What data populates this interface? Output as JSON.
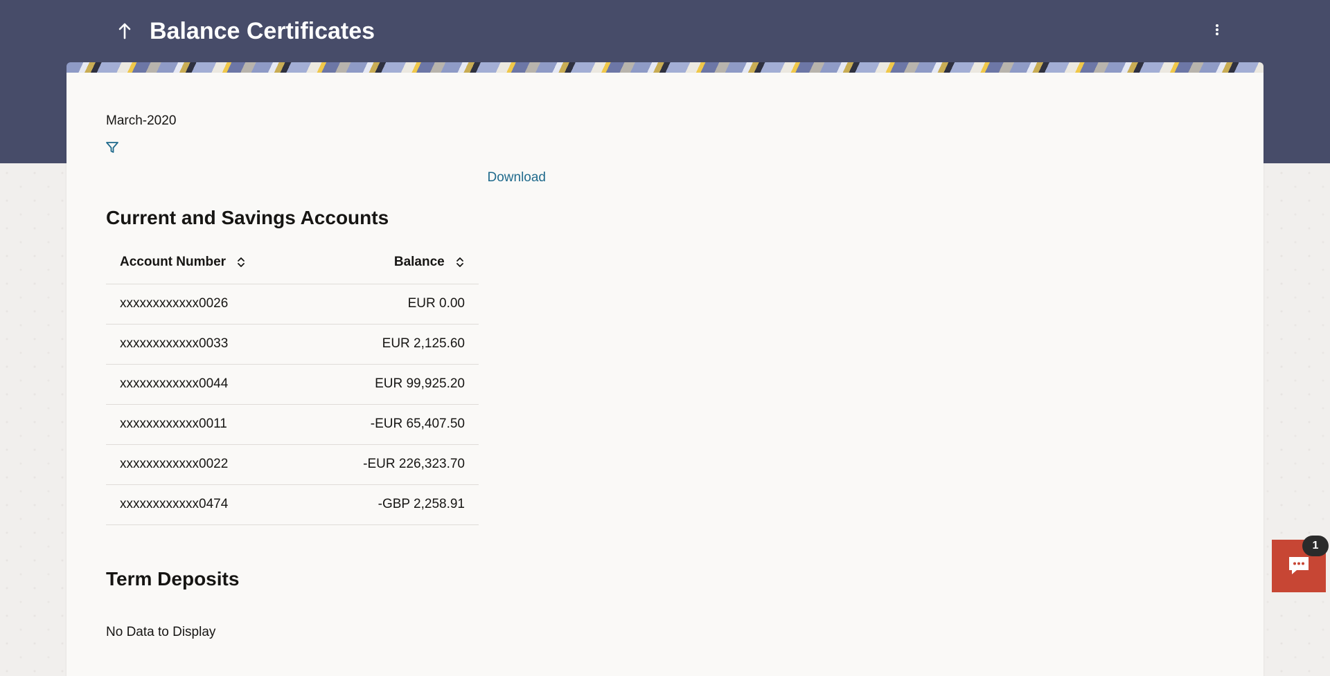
{
  "header": {
    "title": "Balance Certificates",
    "back_icon": "arrow-up-icon",
    "menu_icon": "kebab-menu-icon"
  },
  "filters": {
    "period": "March-2020",
    "filter_icon": "filter-icon"
  },
  "download_label": "Download",
  "casa": {
    "title": "Current and Savings Accounts",
    "columns": {
      "account_number": "Account Number",
      "balance": "Balance"
    },
    "rows": [
      {
        "account": "xxxxxxxxxxxx0026",
        "balance": "EUR 0.00"
      },
      {
        "account": "xxxxxxxxxxxx0033",
        "balance": "EUR 2,125.60"
      },
      {
        "account": "xxxxxxxxxxxx0044",
        "balance": "EUR 99,925.20"
      },
      {
        "account": "xxxxxxxxxxxx0011",
        "balance": "-EUR 65,407.50"
      },
      {
        "account": "xxxxxxxxxxxx0022",
        "balance": "-EUR 226,323.70"
      },
      {
        "account": "xxxxxxxxxxxx0474",
        "balance": "-GBP 2,258.91"
      }
    ]
  },
  "term_deposits": {
    "title": "Term Deposits",
    "empty_message": "No Data to Display"
  },
  "chat": {
    "badge_count": "1",
    "icon": "chat-icon"
  },
  "colors": {
    "header_bg": "#474c69",
    "link": "#1f6a8c",
    "chat_bg": "#c74634",
    "card_bg": "#faf9f7"
  }
}
